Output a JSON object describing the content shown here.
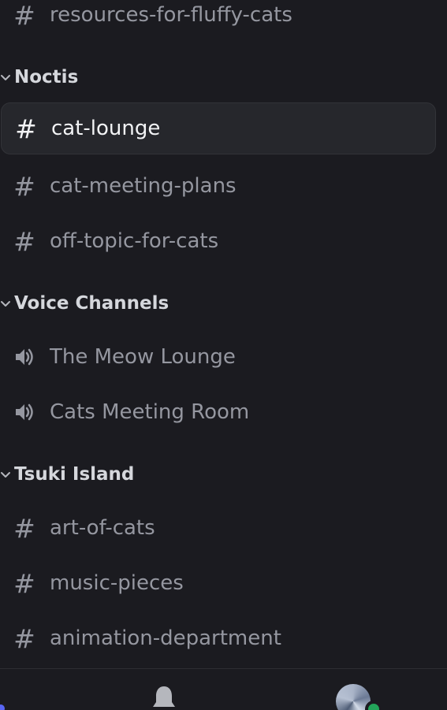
{
  "channels_top": [
    {
      "label": "resources-for-fluffy-cats",
      "icon": "hash-icon"
    }
  ],
  "categories": [
    {
      "name": "Noctis",
      "channels": [
        {
          "label": "cat-lounge",
          "icon": "hash-icon",
          "selected": true
        },
        {
          "label": "cat-meeting-plans",
          "icon": "hash-icon"
        },
        {
          "label": "off-topic-for-cats",
          "icon": "hash-icon"
        }
      ]
    },
    {
      "name": "Voice Channels",
      "channels": [
        {
          "label": "The Meow Lounge",
          "icon": "speaker-icon"
        },
        {
          "label": "Cats Meeting Room",
          "icon": "speaker-icon"
        }
      ]
    },
    {
      "name": "Tsuki Island",
      "channels": [
        {
          "label": "art-of-cats",
          "icon": "hash-icon"
        },
        {
          "label": "music-pieces",
          "icon": "hash-icon"
        },
        {
          "label": "animation-department",
          "icon": "hash-icon"
        }
      ]
    }
  ],
  "bottom_nav": {
    "items": [
      "home-icon",
      "bell-icon",
      "avatar"
    ],
    "status": "online"
  },
  "colors": {
    "background": "#1b1b20",
    "selected_row": "#26272c",
    "channel_text": "#9597a0",
    "selected_text": "#f2f3f5",
    "category_text": "#d5d7dc",
    "online": "#23a55a",
    "accent": "#5865f2"
  }
}
